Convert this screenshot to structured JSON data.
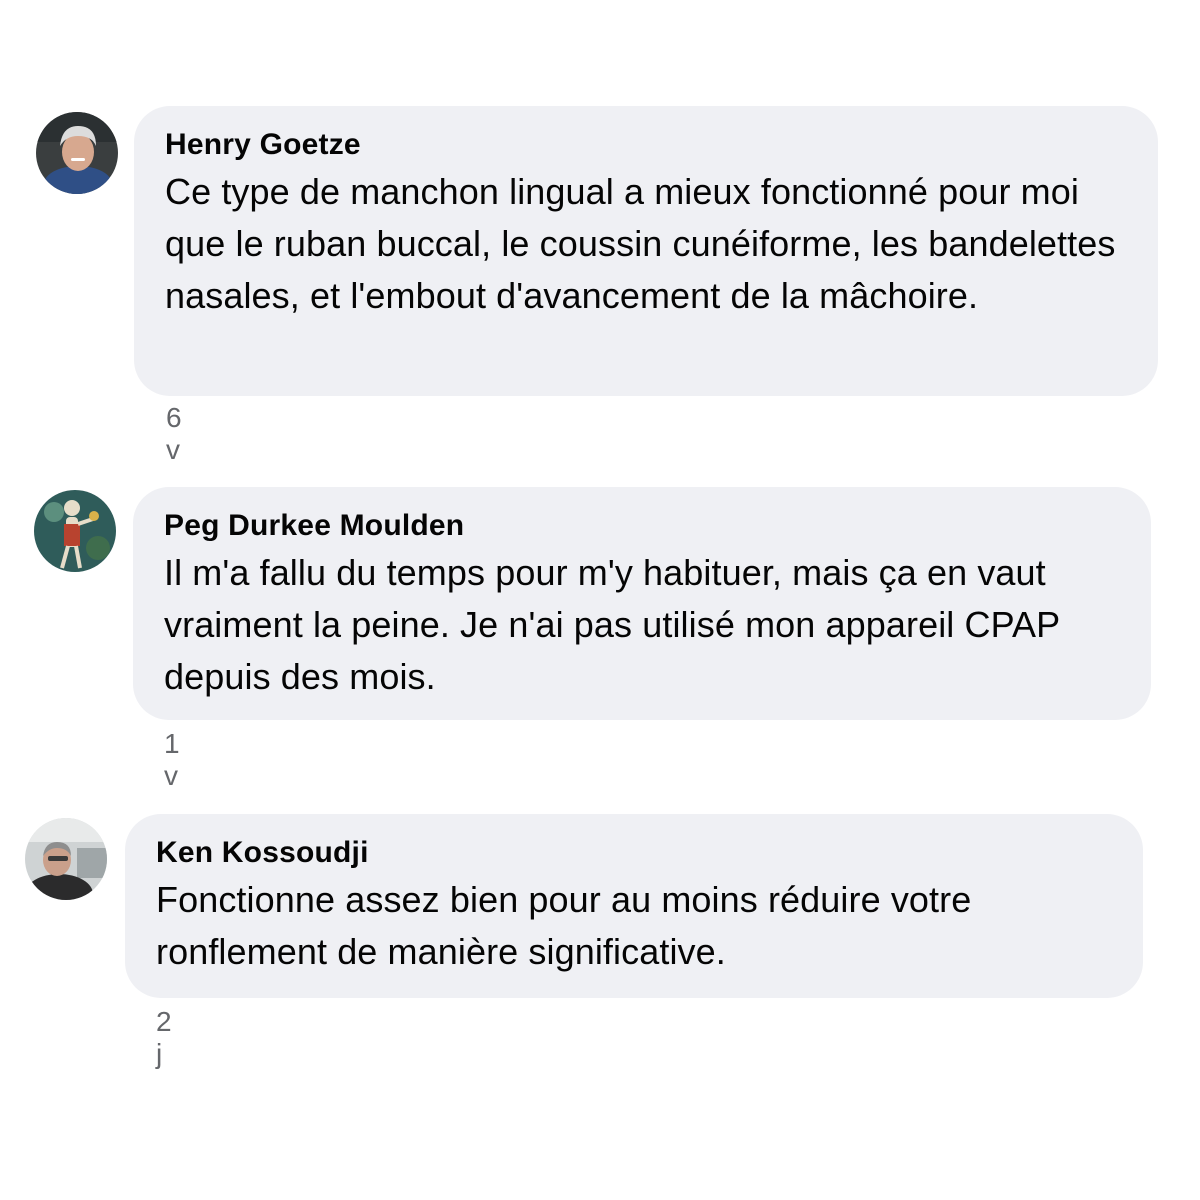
{
  "comments": [
    {
      "author": "Henry Goetze",
      "text": "Ce type de manchon lingual a mieux fonctionné pour moi que le ruban buccal, le coussin cunéiforme, les bandelettes nasales, et l'embout d'avancement de la mâchoire.",
      "time": "6 v",
      "avatar_icon": "avatar-photo-icon"
    },
    {
      "author": "Peg Durkee Moulden",
      "text": "Il m'a fallu du temps pour m'y habituer, mais ça en vaut vraiment la peine. Je n'ai pas utilisé mon appareil CPAP depuis des mois.",
      "time": "1 v",
      "avatar_icon": "avatar-skeleton-art-icon"
    },
    {
      "author": "Ken Kossoudji",
      "text": "Fonctionne assez bien pour au moins réduire votre ronflement de manière significative.",
      "time": "2 j",
      "avatar_icon": "avatar-photo-icon"
    }
  ],
  "colors": {
    "bubble": "#eff0f4",
    "text": "#050505",
    "meta": "#65676b"
  }
}
